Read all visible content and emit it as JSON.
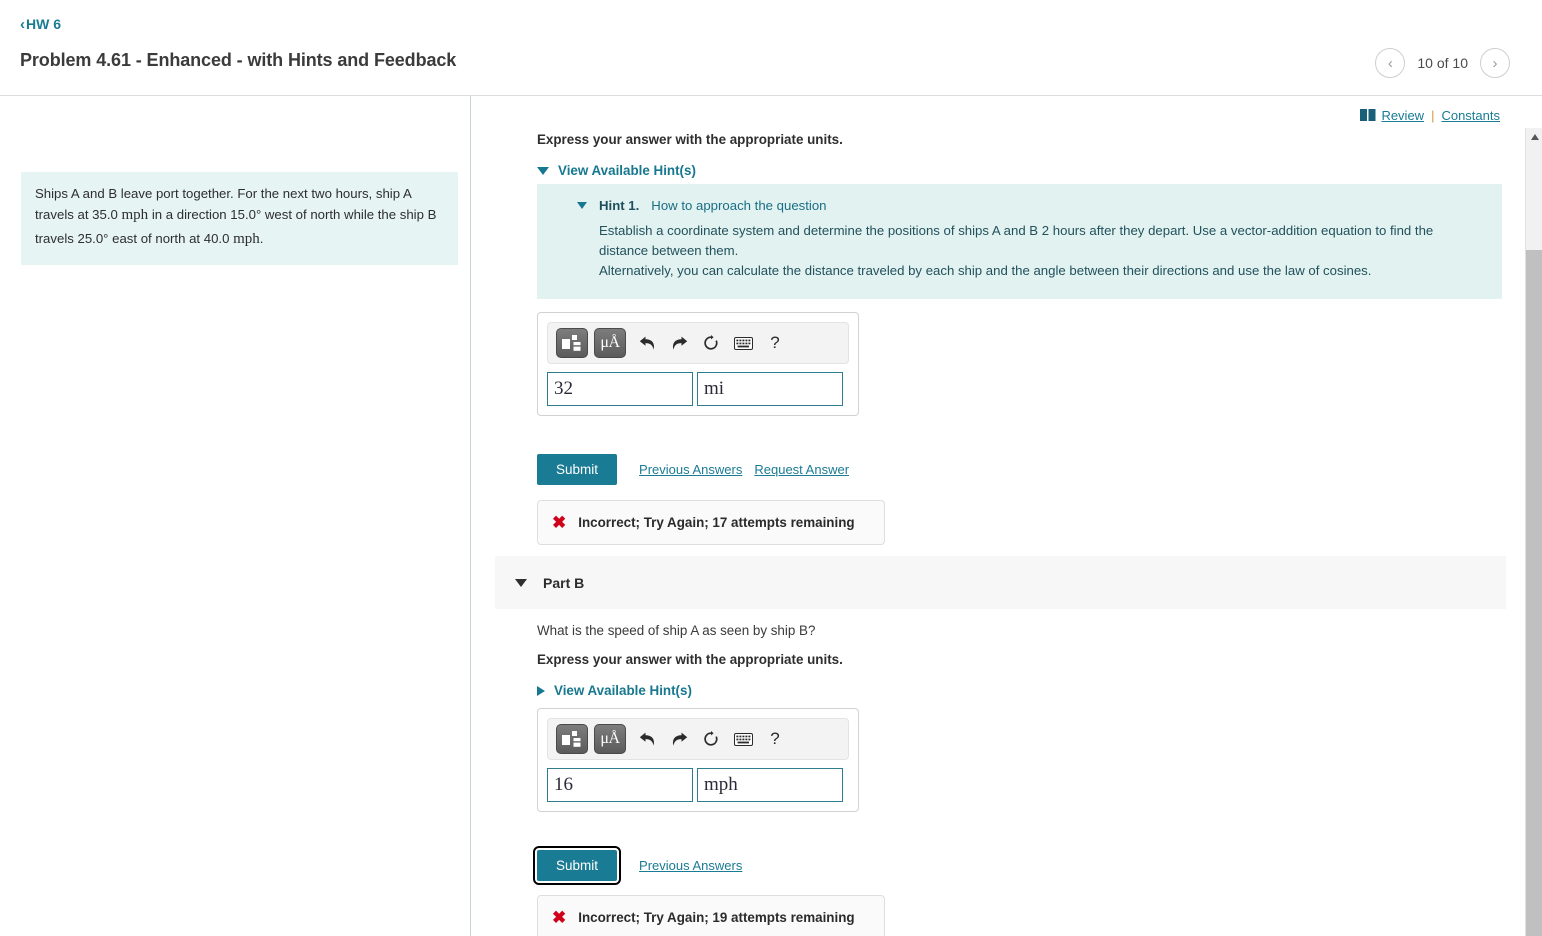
{
  "header": {
    "breadcrumb_chevron": "‹",
    "breadcrumb_label": "HW 6",
    "title": "Problem 4.61 - Enhanced - with Hints and Feedback",
    "pager": {
      "prev_icon": "‹",
      "next_icon": "›",
      "label": "10 of 10"
    }
  },
  "toolbar_links": {
    "book_icon": "▌▌",
    "review": "Review",
    "separator": "|",
    "constants": "Constants"
  },
  "problem_statement": {
    "line1": "Ships A and B leave port together. For the next two hours, ship A",
    "line2_pre": "travels at 35.0 ",
    "line2_unit": "mph",
    "line2_post": " in a direction 15.0° west of north while the ship B",
    "line3_pre": "travels 25.0° east of north at 40.0 ",
    "line3_unit": "mph",
    "line3_post": "."
  },
  "part_a": {
    "express_units": "Express your answer with the appropriate units.",
    "hint_link": "View Available Hint(s)",
    "hint": {
      "label": "Hint 1.",
      "subtitle": "How to approach the question",
      "paragraph1": "Establish a coordinate system and determine the positions of ships A and B 2 hours after they depart. Use a vector-addition equation to find the distance between them.",
      "paragraph2": "Alternatively, you can calculate the distance traveled by each ship and the angle between their directions and use the law of cosines."
    },
    "answer": {
      "value": "32",
      "units": "mi",
      "value_placeholder": "",
      "units_placeholder": ""
    },
    "tools": {
      "template_icon": "template-icon",
      "symbols_label": "μÅ",
      "undo_icon": "↰",
      "redo_icon": "↱",
      "reset_icon": "↺",
      "keyboard_icon": "⌨",
      "help_icon": "?"
    },
    "submit_label": "Submit",
    "previous_answers": "Previous Answers",
    "request_answer": "Request Answer",
    "feedback": {
      "icon": "✖",
      "text": "Incorrect; Try Again; 17 attempts remaining"
    }
  },
  "part_b": {
    "band_label": "Part B",
    "question": "What is the speed of ship A as seen by ship B?",
    "express_units": "Express your answer with the appropriate units.",
    "hint_link": "View Available Hint(s)",
    "answer": {
      "value": "16",
      "units": "mph",
      "value_placeholder": "",
      "units_placeholder": ""
    },
    "tools": {
      "symbols_label": "μÅ",
      "undo_icon": "↰",
      "redo_icon": "↱",
      "reset_icon": "↺",
      "keyboard_icon": "⌨",
      "help_icon": "?"
    },
    "submit_label": "Submit",
    "previous_answers": "Previous Answers",
    "feedback": {
      "icon": "✖",
      "text": "Incorrect; Try Again; 19 attempts remaining"
    }
  },
  "colors": {
    "accent": "#1a7b94",
    "hint_bg": "#e2f2f1",
    "problem_bg": "#e6f4f4",
    "error": "#d0021b",
    "band_bg": "#f7f7f7"
  }
}
